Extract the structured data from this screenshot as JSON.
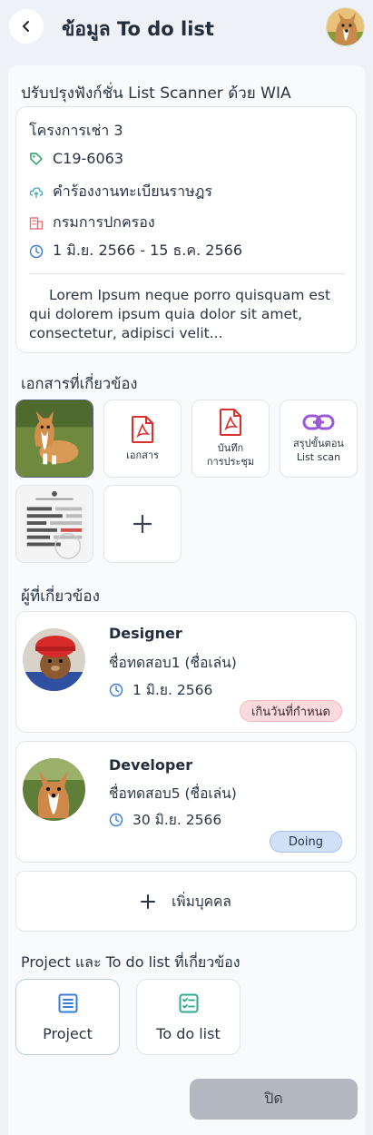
{
  "header": {
    "title": "ข้อมูล To do list"
  },
  "task": {
    "title": "ปรับปรุงฟังก์ชั่น List Scanner ด้วย WIA",
    "project": "โครงการเช่า 3",
    "code": "C19-6063",
    "category": "คำร้องงานทะเบียนราษฎร",
    "department": "กรมการปกครอง",
    "date_range": "1 มิ.ย. 2566 - 15 ธ.ค. 2566",
    "description": "Lorem Ipsum neque porro quisquam est qui dolorem ipsum quia dolor sit amet, consectetur, adipisci velit..."
  },
  "documents": {
    "title": "เอกสารที่เกี่ยวข้อง",
    "items": [
      {
        "type": "image",
        "icon": "dog-photo"
      },
      {
        "type": "pdf",
        "label": "เอกสาร",
        "icon": "pdf-icon"
      },
      {
        "type": "pdf",
        "label_line1": "บันทึก",
        "label_line2": "การประชุม",
        "icon": "pdf-icon"
      },
      {
        "type": "link",
        "label_line1": "สรุปขั้นตอน",
        "label_line2": "List scan",
        "icon": "link-icon"
      },
      {
        "type": "image",
        "icon": "document-photo"
      },
      {
        "type": "add",
        "icon": "plus-icon"
      }
    ]
  },
  "people": {
    "title": "ผู้ที่เกี่ยวข้อง",
    "items": [
      {
        "role": "Designer",
        "name": "ชื่อทดสอบ1 (ชื่อเล่น)",
        "date": "1 มิ.ย. 2566",
        "status": "เกินวันที่กำหนด",
        "status_color": "#fbdadd"
      },
      {
        "role": "Developer",
        "name": "ชื่อทดสอบ5 (ชื่อเล่น)",
        "date": "30 มิ.ย. 2566",
        "status": "Doing",
        "status_color": "#cfe0f7"
      }
    ],
    "add_label": "เพิ่มบุคคล"
  },
  "related": {
    "title": "Project และ To do list ที่เกี่ยวข้อง",
    "items": [
      {
        "label": "Project",
        "icon": "list-icon"
      },
      {
        "label": "To do list",
        "icon": "checklist-icon"
      }
    ]
  },
  "footer": {
    "close_label": "ปิด"
  },
  "colors": {
    "accent": "#3a7bd5",
    "pdf": "#d9302c",
    "link": "#9b59d6",
    "overdue_bg": "#fbdadd",
    "doing_bg": "#cfe0f7"
  }
}
